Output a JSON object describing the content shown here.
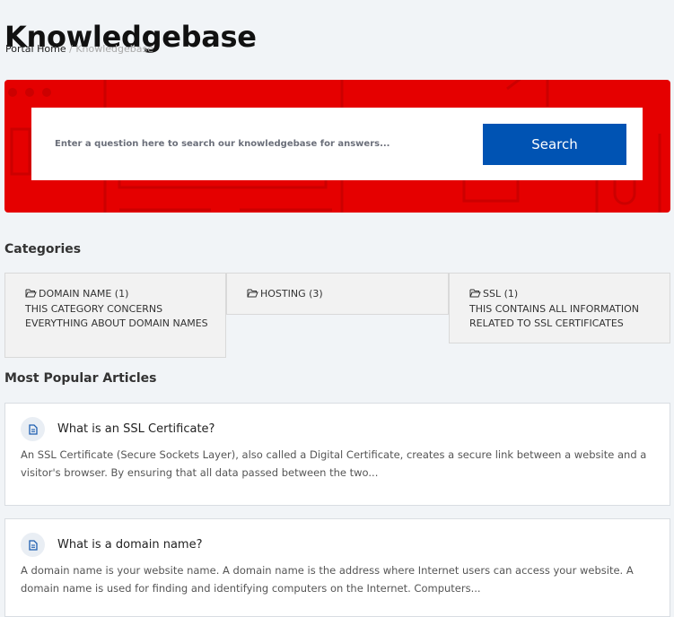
{
  "page": {
    "title": "Knowledgebase"
  },
  "breadcrumb": {
    "home": "Portal Home",
    "separator": "/",
    "current": "Knowledgebase"
  },
  "search": {
    "placeholder": "Enter a question here to search our knowledgebase for answers...",
    "value": "",
    "button_label": "Search"
  },
  "colors": {
    "hero_background": "#e50000",
    "search_button": "#0053b3",
    "page_background": "#f1f4f7"
  },
  "categories": {
    "heading": "Categories",
    "items": [
      {
        "icon": "folder-open-icon",
        "name": "DOMAIN NAME (1)",
        "description": "THIS CATEGORY CONCERNS EVERYTHING ABOUT DOMAIN NAMES"
      },
      {
        "icon": "folder-open-icon",
        "name": "HOSTING (3)",
        "description": ""
      },
      {
        "icon": "folder-open-icon",
        "name": "SSL (1)",
        "description": "THIS CONTAINS ALL INFORMATION RELATED TO SSL CERTIFICATES"
      }
    ]
  },
  "popular": {
    "heading": "Most Popular Articles",
    "articles": [
      {
        "icon": "document-icon",
        "title": "What is an SSL Certificate?",
        "excerpt": "An SSL Certificate (Secure Sockets Layer), also called a Digital Certificate, creates a secure link between a website and a visitor's browser. By ensuring that all data passed between the two..."
      },
      {
        "icon": "document-icon",
        "title": "What is a domain name?",
        "excerpt": "A domain name is your website name. A domain name is the address where Internet users can access your website. A domain name is used for finding and identifying computers on the Internet. Computers..."
      }
    ]
  }
}
